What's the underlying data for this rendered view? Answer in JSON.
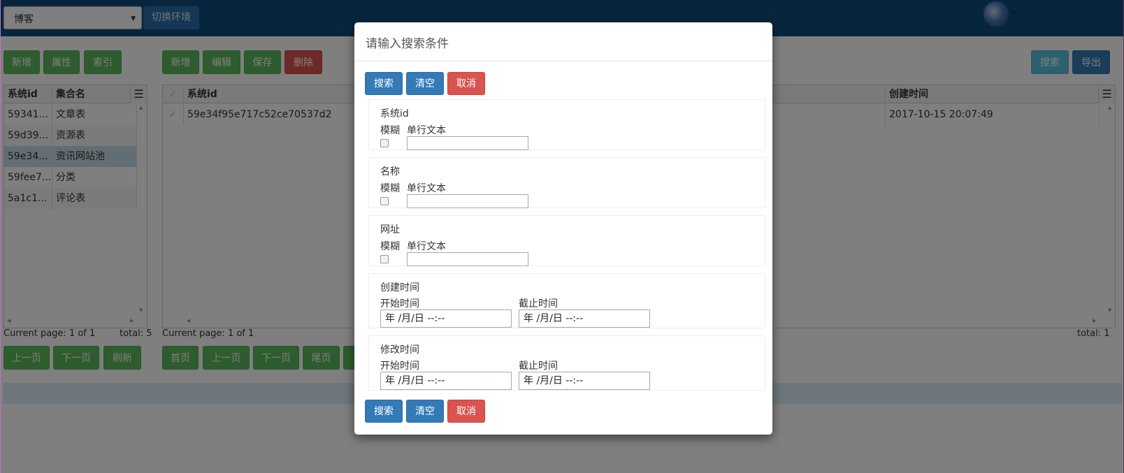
{
  "topbar": {
    "env_value": "博客",
    "env_button": "切换环境"
  },
  "left_toolbar": {
    "add": "新增",
    "props": "属性",
    "index": "索引"
  },
  "left_grid": {
    "headers": [
      "系统id",
      "集合名"
    ],
    "rows": [
      [
        "59341...",
        "文章表"
      ],
      [
        "59d39...",
        "资源表"
      ],
      [
        "59e34...",
        "资讯网站池"
      ],
      [
        "59fee7...",
        "分类"
      ],
      [
        "5a1c1...",
        "评论表"
      ]
    ],
    "page_info": "Current page: 1 of 1",
    "total": "total: 5"
  },
  "left_pager": {
    "prev": "上一页",
    "next": "下一页",
    "refresh": "刷新"
  },
  "main_toolbar": {
    "add": "新增",
    "edit": "编辑",
    "save": "保存",
    "delete": "删除",
    "search": "搜索",
    "export": "导出"
  },
  "main_grid": {
    "headers": [
      "系统id",
      "创建时间"
    ],
    "row": {
      "id": "59e34f95e717c52ce70537d2",
      "created": "2017-10-15 20:07:49"
    },
    "page_info": "Current page: 1 of 1",
    "total": "total: 1"
  },
  "main_pager": {
    "first": "首页",
    "prev": "上一页",
    "next": "下一页",
    "last": "尾页"
  },
  "modal": {
    "title": "请输入搜索条件",
    "search": "搜索",
    "clear": "清空",
    "cancel": "取消",
    "fields": [
      {
        "label": "系统id",
        "fuzzy": "模糊",
        "type_label": "单行文本"
      },
      {
        "label": "名称",
        "fuzzy": "模糊",
        "type_label": "单行文本"
      },
      {
        "label": "网址",
        "fuzzy": "模糊",
        "type_label": "单行文本"
      }
    ],
    "date_fields": [
      {
        "label": "创建时间",
        "start": "开始时间",
        "end": "截止时间",
        "placeholder": "年 /月/日 --:--"
      },
      {
        "label": "修改时间",
        "start": "开始时间",
        "end": "截止时间",
        "placeholder": "年 /月/日 --:--"
      }
    ]
  },
  "colors": {
    "topbar": "#0f4d7a",
    "green": "#5cb85c",
    "red": "#d9534f",
    "blue": "#337ab7",
    "info": "#5bc0de"
  }
}
